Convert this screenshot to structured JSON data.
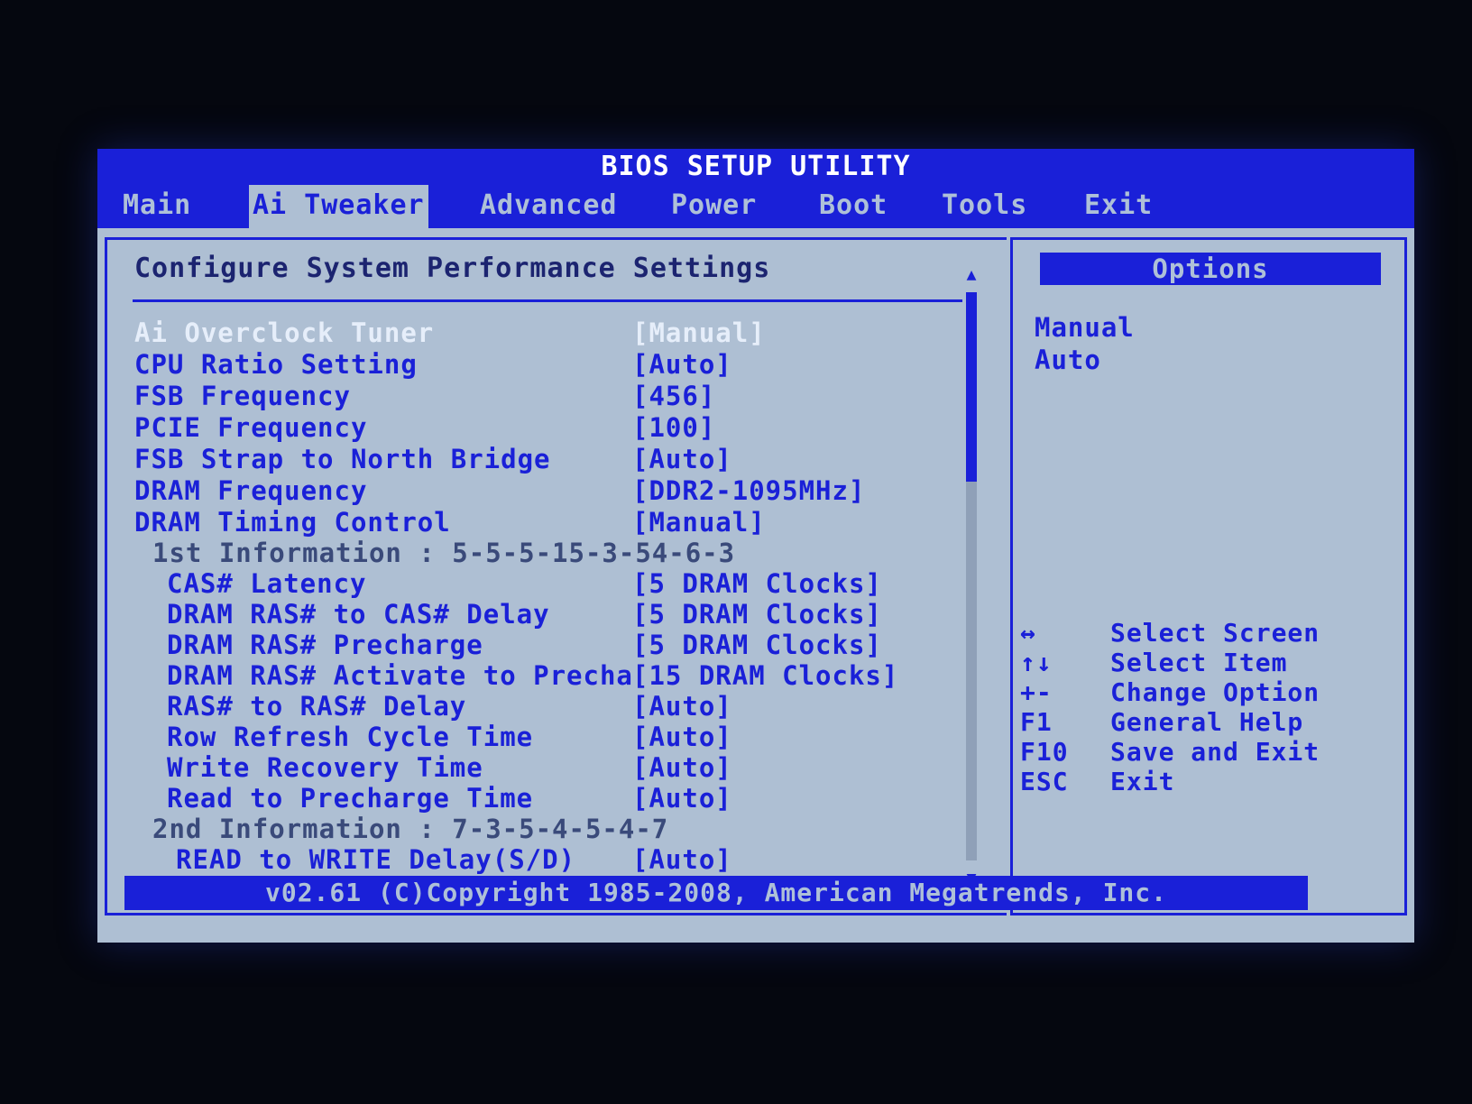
{
  "title": "BIOS SETUP UTILITY",
  "menu": [
    {
      "label": "Main"
    },
    {
      "label": "Ai Tweaker",
      "active": true
    },
    {
      "label": "Advanced"
    },
    {
      "label": "Power"
    },
    {
      "label": "Boot"
    },
    {
      "label": "Tools"
    },
    {
      "label": "Exit"
    }
  ],
  "main": {
    "heading": "Configure System Performance Settings",
    "rows": [
      {
        "label": "Ai Overclock Tuner",
        "value": "[Manual]",
        "selected": true
      },
      {
        "label": "CPU Ratio Setting",
        "value": "[Auto]"
      },
      {
        "label": "FSB Frequency",
        "value": "[456]"
      },
      {
        "label": "PCIE Frequency",
        "value": "[100]"
      },
      {
        "label": "FSB Strap to North Bridge",
        "value": "[Auto]"
      },
      {
        "label": "DRAM Frequency",
        "value": "[DDR2-1095MHz]"
      },
      {
        "label": "DRAM Timing Control",
        "value": "[Manual]"
      },
      {
        "label": "1st Information : 5-5-5-15-3-54-6-3",
        "value": "",
        "info": true
      },
      {
        "label": "CAS# Latency",
        "value": "[5 DRAM Clocks]"
      },
      {
        "label": "DRAM RAS# to CAS# Delay",
        "value": "[5 DRAM Clocks]"
      },
      {
        "label": "DRAM RAS# Precharge",
        "value": "[5 DRAM Clocks]"
      },
      {
        "label": "DRAM RAS# Activate to Precha",
        "value": "[15 DRAM Clocks]"
      },
      {
        "label": "RAS# to RAS# Delay",
        "value": "[Auto]"
      },
      {
        "label": "Row Refresh Cycle Time",
        "value": "[Auto]"
      },
      {
        "label": "Write Recovery Time",
        "value": "[Auto]"
      },
      {
        "label": "Read to Precharge Time",
        "value": "[Auto]"
      },
      {
        "label": "2nd Information : 7-3-5-4-5-4-7",
        "value": "",
        "info": true
      },
      {
        "label": "READ to WRITE Delay(S/D)",
        "value": "[Auto]"
      }
    ]
  },
  "options": {
    "header": "Options",
    "items": [
      "Manual",
      "Auto"
    ]
  },
  "keys": [
    {
      "key": "↔",
      "desc": "Select Screen"
    },
    {
      "key": "↑↓",
      "desc": "Select Item"
    },
    {
      "key": "+-",
      "desc": "Change Option"
    },
    {
      "key": "F1",
      "desc": "General Help"
    },
    {
      "key": "F10",
      "desc": "Save and Exit"
    },
    {
      "key": "ESC",
      "desc": "Exit"
    }
  ],
  "footer": "v02.61 (C)Copyright 1985-2008, American Megatrends, Inc.",
  "colors": {
    "background": "#aebfd3",
    "accent": "#1a20d8"
  }
}
